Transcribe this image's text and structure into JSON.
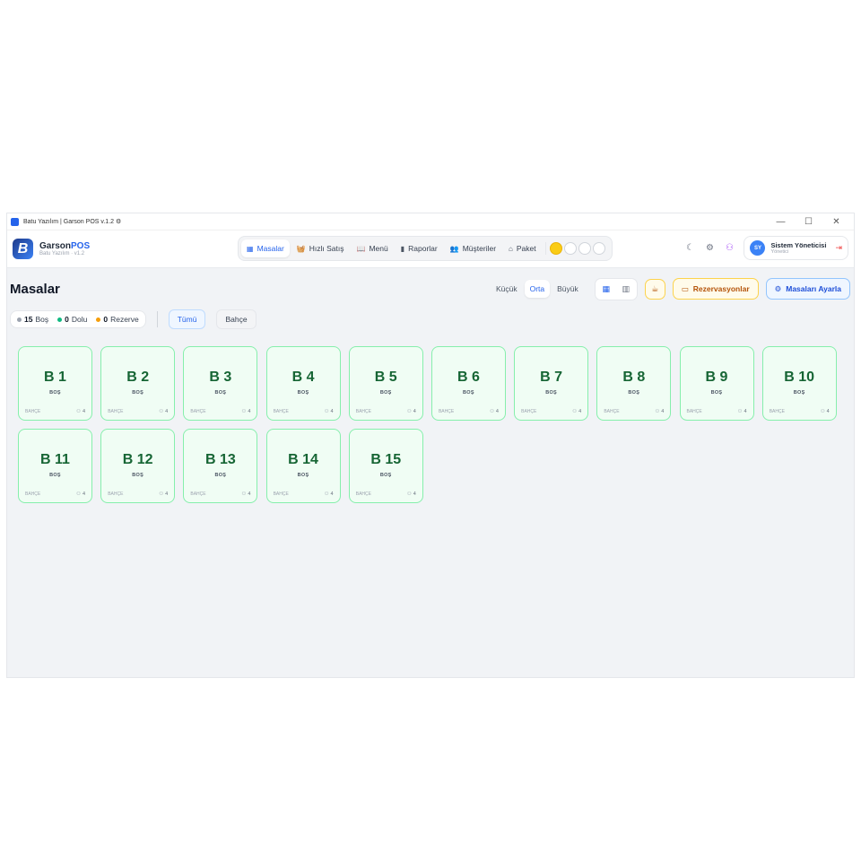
{
  "window": {
    "title": "Batu Yazılım | Garson POS v.1.2 ⚙",
    "controls": [
      "—",
      "☐",
      "✕"
    ]
  },
  "brand": {
    "mark": "B",
    "name_main": "Garson",
    "name_accent": "POS",
    "sub": "Batu Yazılım · v1.2"
  },
  "nav": [
    {
      "label": "Masalar",
      "icon": "▦"
    },
    {
      "label": "Hızlı Satış",
      "icon": "🧺"
    },
    {
      "label": "Menü",
      "icon": "📖"
    },
    {
      "label": "Raporlar",
      "icon": "▮"
    },
    {
      "label": "Müşteriler",
      "icon": "👥"
    },
    {
      "label": "Paket",
      "icon": "⌂"
    }
  ],
  "user": {
    "initials": "SY",
    "name": "Sistem Yöneticisi",
    "role": "Yönetici"
  },
  "page": {
    "title": "Masalar"
  },
  "sizes": [
    "Küçük",
    "Orta",
    "Büyük"
  ],
  "actions": {
    "reservations": "Rezervasyonlar",
    "settings": "Masaları Ayarla"
  },
  "stats": [
    {
      "count": "15",
      "label": "Boş",
      "color": "#9ca3af"
    },
    {
      "count": "0",
      "label": "Dolu",
      "color": "#10b981"
    },
    {
      "count": "0",
      "label": "Rezerve",
      "color": "#f59e0b"
    }
  ],
  "areas": [
    "Tümü",
    "Bahçe"
  ],
  "tables": [
    {
      "name": "B 1",
      "status": "BOŞ",
      "area": "BAHÇE",
      "capacity": "4"
    },
    {
      "name": "B 2",
      "status": "BOŞ",
      "area": "BAHÇE",
      "capacity": "4"
    },
    {
      "name": "B 3",
      "status": "BOŞ",
      "area": "BAHÇE",
      "capacity": "4"
    },
    {
      "name": "B 4",
      "status": "BOŞ",
      "area": "BAHÇE",
      "capacity": "4"
    },
    {
      "name": "B 5",
      "status": "BOŞ",
      "area": "BAHÇE",
      "capacity": "4"
    },
    {
      "name": "B 6",
      "status": "BOŞ",
      "area": "BAHÇE",
      "capacity": "4"
    },
    {
      "name": "B 7",
      "status": "BOŞ",
      "area": "BAHÇE",
      "capacity": "4"
    },
    {
      "name": "B 8",
      "status": "BOŞ",
      "area": "BAHÇE",
      "capacity": "4"
    },
    {
      "name": "B 9",
      "status": "BOŞ",
      "area": "BAHÇE",
      "capacity": "4"
    },
    {
      "name": "B 10",
      "status": "BOŞ",
      "area": "BAHÇE",
      "capacity": "4"
    },
    {
      "name": "B 11",
      "status": "BOŞ",
      "area": "BAHÇE",
      "capacity": "4"
    },
    {
      "name": "B 12",
      "status": "BOŞ",
      "area": "BAHÇE",
      "capacity": "4"
    },
    {
      "name": "B 13",
      "status": "BOŞ",
      "area": "BAHÇE",
      "capacity": "4"
    },
    {
      "name": "B 14",
      "status": "BOŞ",
      "area": "BAHÇE",
      "capacity": "4"
    },
    {
      "name": "B 15",
      "status": "BOŞ",
      "area": "BAHÇE",
      "capacity": "4"
    }
  ]
}
